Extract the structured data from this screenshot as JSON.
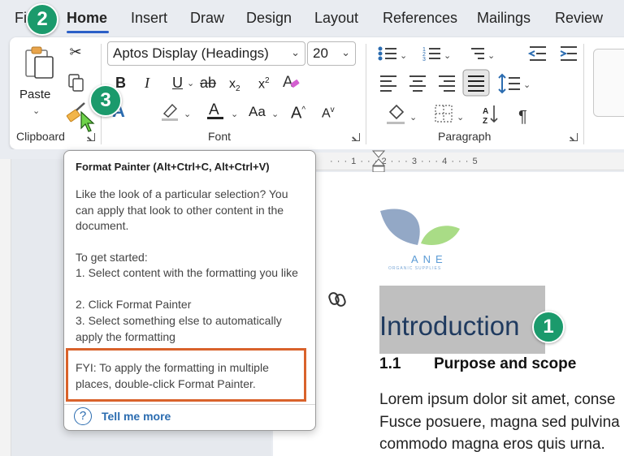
{
  "tabs": [
    {
      "label": "File",
      "shown": "Fi"
    },
    {
      "label": "Home"
    },
    {
      "label": "Insert"
    },
    {
      "label": "Draw"
    },
    {
      "label": "Design"
    },
    {
      "label": "Layout"
    },
    {
      "label": "References"
    },
    {
      "label": "Mailings"
    },
    {
      "label": "Review"
    }
  ],
  "clipboard": {
    "paste_label": "Paste",
    "group_label": "Clipboard"
  },
  "font": {
    "family": "Aptos Display (Headings)",
    "size": "20",
    "group_label": "Font",
    "change_case": "Aa"
  },
  "paragraph": {
    "group_label": "Paragraph"
  },
  "callouts": {
    "c1": "1",
    "c2": "2",
    "c3": "3"
  },
  "tooltip": {
    "title": "Format Painter (Alt+Ctrl+C, Alt+Ctrl+V)",
    "para1": "Like the look of a particular selection? You can apply that look to other content in the document.",
    "para2_intro": "To get started:",
    "step1": "1. Select content with the formatting you like",
    "step2": "2. Click Format Painter",
    "step3": "3. Select something else to automatically apply the formatting",
    "fyi": "FYI: To apply the formatting in multiple places, double-click Format Painter.",
    "tell_more": "Tell me more"
  },
  "document": {
    "logo_text": "ANE",
    "logo_subtext": "ORGANIC SUPPLIES",
    "heading": "Introduction",
    "section_num": "1.1",
    "section_title": "Purpose and scope",
    "body_lines": [
      "Lorem ipsum dolor sit amet, conse",
      "Fusce posuere, magna sed pulvina",
      "commodo magna eros quis urna."
    ]
  },
  "ruler_text": "· · · 1 · · · 2 · · · 3 · · · 4 · · · 5",
  "colors": {
    "accent": "#2b5fc7",
    "callout": "#1b9a6c",
    "highlight_box": "#d9622b"
  }
}
